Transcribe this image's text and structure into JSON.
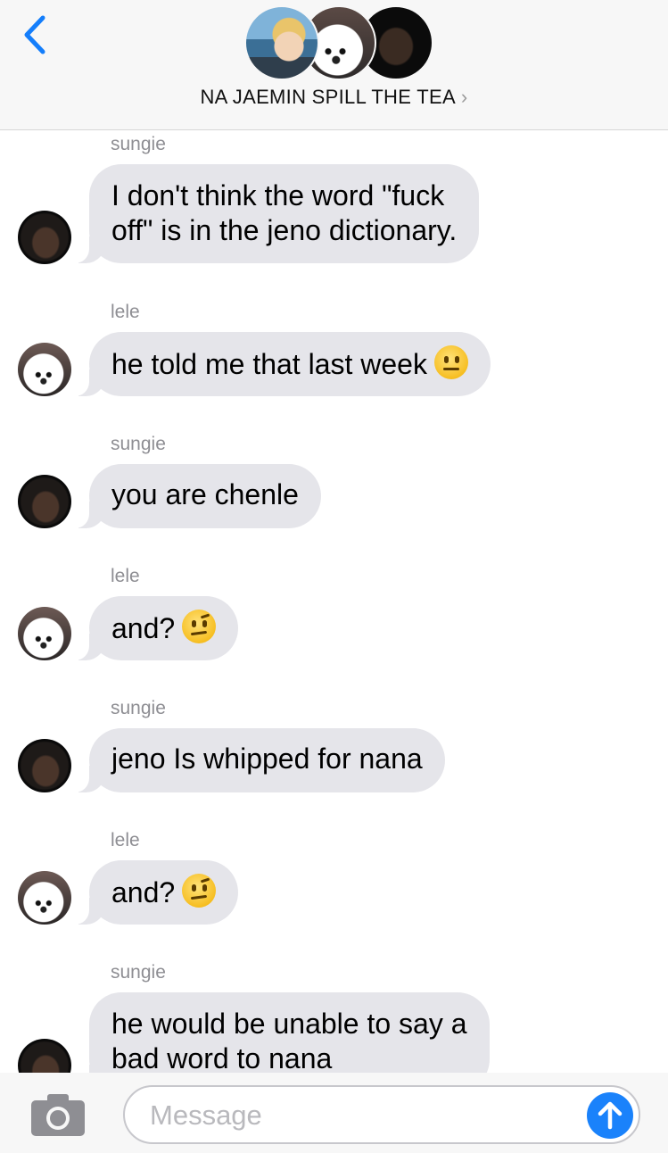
{
  "header": {
    "title": "NA JAEMIN SPILL THE TEA",
    "chevron": "›",
    "accent_color": "#147efb"
  },
  "messages": [
    {
      "sender": "sungie",
      "avatar": "dark",
      "lines": [
        "I don't think the word \"fuck",
        "off\" is in the jeno dictionary."
      ],
      "emoji": null
    },
    {
      "sender": "lele",
      "avatar": "dog",
      "lines": [
        "he told me that last week"
      ],
      "emoji": "neutral-face"
    },
    {
      "sender": "sungie",
      "avatar": "dark",
      "lines": [
        "you are chenle"
      ],
      "emoji": null
    },
    {
      "sender": "lele",
      "avatar": "dog",
      "lines": [
        "and?"
      ],
      "emoji": "raised-eyebrow-face"
    },
    {
      "sender": "sungie",
      "avatar": "dark",
      "lines": [
        "jeno Is whipped for nana"
      ],
      "emoji": null
    },
    {
      "sender": "lele",
      "avatar": "dog",
      "lines": [
        "and?"
      ],
      "emoji": "raised-eyebrow-face"
    },
    {
      "sender": "sungie",
      "avatar": "dark",
      "lines": [
        "he would be unable to say a",
        "bad word to nana"
      ],
      "emoji": null
    }
  ],
  "compose": {
    "placeholder": "Message",
    "value": ""
  },
  "icons": {
    "back": "back-chevron-icon",
    "camera": "camera-icon",
    "send": "send-arrow-icon"
  }
}
